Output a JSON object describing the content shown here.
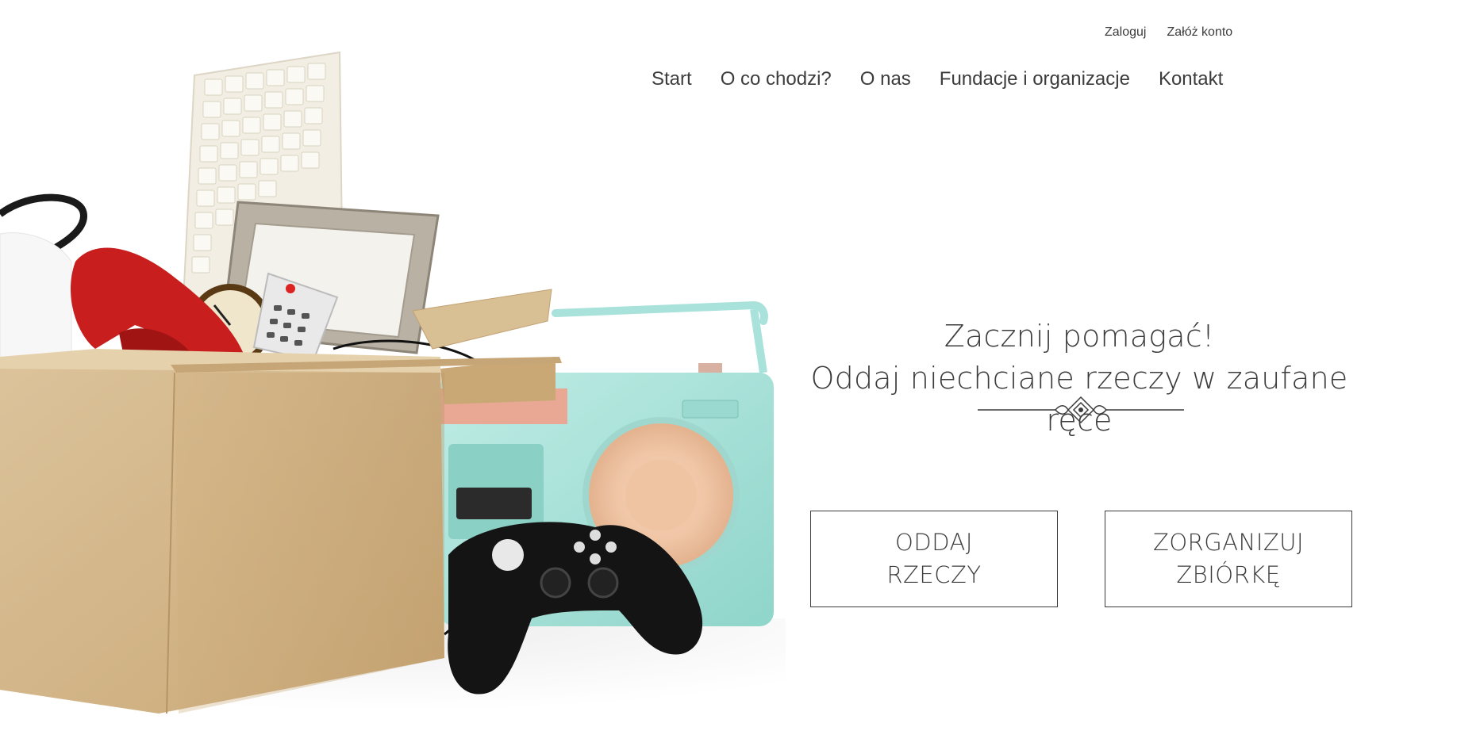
{
  "header": {
    "auth_links": {
      "login": "Zaloguj",
      "register": "Załóż konto"
    },
    "nav": [
      {
        "label": "Start"
      },
      {
        "label": "O co chodzi?"
      },
      {
        "label": "O nas"
      },
      {
        "label": "Fundacje i organizacje"
      },
      {
        "label": "Kontakt"
      }
    ]
  },
  "hero": {
    "title_line1": "Zacznij pomagać!",
    "title_line2": "Oddaj niechciane rzeczy w zaufane ręce",
    "buttons": {
      "give": "ODDAJ\nRZECZY",
      "organize": "ZORGANIZUJ\nZBIÓRKĘ"
    }
  },
  "colors": {
    "text": "#3c3c3c",
    "box": "#d9bb8d",
    "radio": "#a9e2da",
    "phone": "#c81e1e"
  },
  "icons": [
    "decoration-ornament-icon"
  ]
}
